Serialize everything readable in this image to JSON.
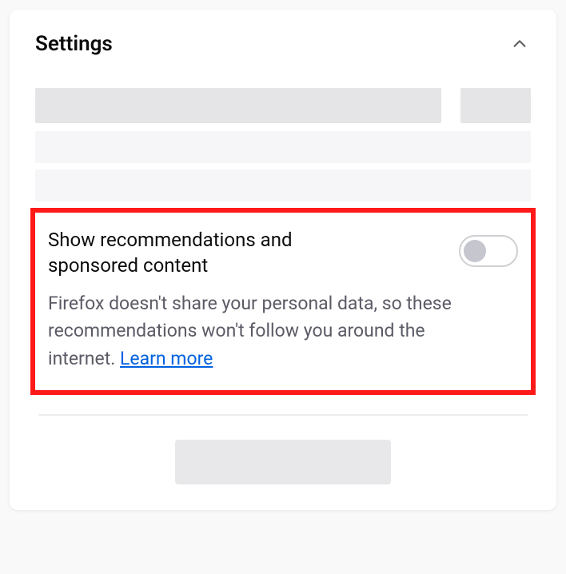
{
  "panel": {
    "title": "Settings"
  },
  "recommendations": {
    "label": "Show recommendations and sponsored content",
    "description_prefix": "Firefox doesn't share your personal data, so these recommendations won't follow you around the internet. ",
    "learn_more": "Learn more",
    "toggle_state": "off"
  }
}
